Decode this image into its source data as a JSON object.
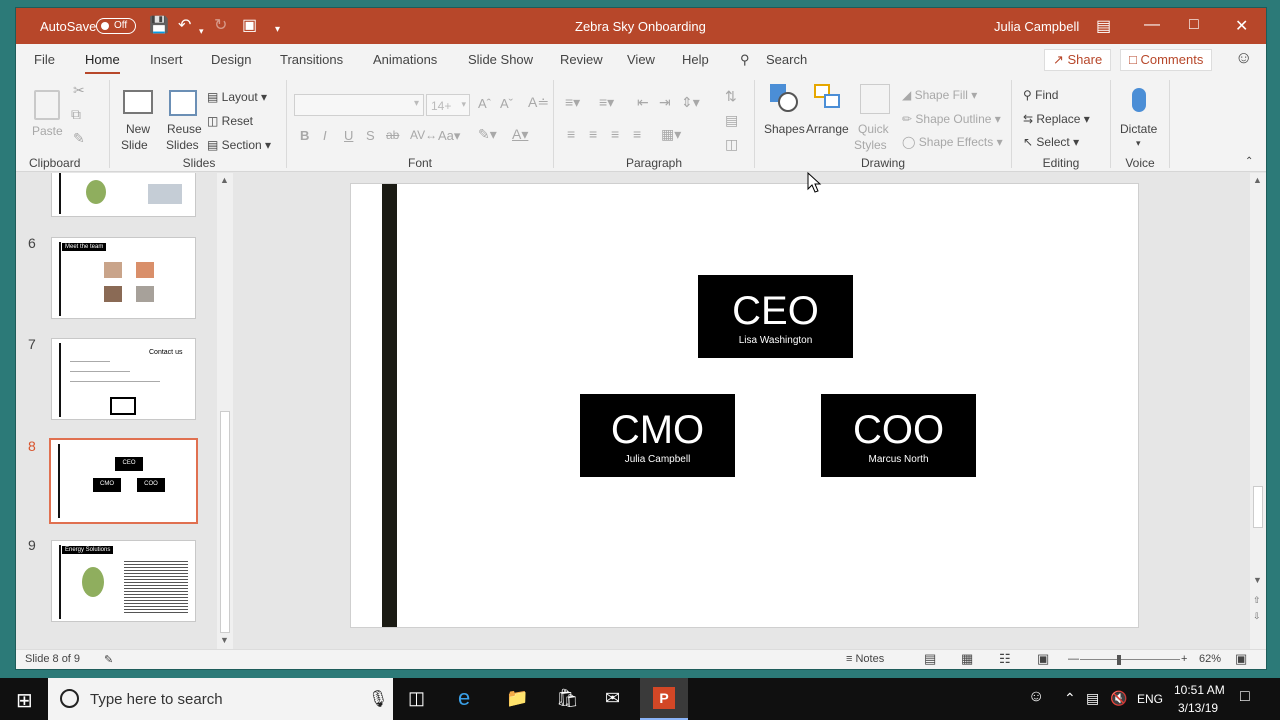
{
  "title_bar": {
    "autosave_label": "AutoSave",
    "autosave_state": "Off",
    "doc_title": "Zebra Sky Onboarding",
    "user_name": "Julia Campbell"
  },
  "tabs": [
    "File",
    "Home",
    "Insert",
    "Design",
    "Transitions",
    "Animations",
    "Slide Show",
    "Review",
    "View",
    "Help"
  ],
  "search_label": "Search",
  "share_label": "Share",
  "comments_label": "Comments",
  "ribbon": {
    "clipboard": {
      "paste": "Paste",
      "group": "Clipboard"
    },
    "slides": {
      "new_slide_1": "New",
      "new_slide_2": "Slide",
      "reuse_1": "Reuse",
      "reuse_2": "Slides",
      "layout": "Layout",
      "reset": "Reset",
      "section": "Section",
      "group": "Slides"
    },
    "font": {
      "size": "14+",
      "group": "Font"
    },
    "paragraph": {
      "group": "Paragraph"
    },
    "drawing": {
      "shapes": "Shapes",
      "arrange": "Arrange",
      "quick_1": "Quick",
      "quick_2": "Styles",
      "shape_fill": "Shape Fill",
      "shape_outline": "Shape Outline",
      "shape_effects": "Shape Effects",
      "group": "Drawing"
    },
    "editing": {
      "find": "Find",
      "replace": "Replace",
      "select": "Select",
      "group": "Editing"
    },
    "voice": {
      "dictate": "Dictate",
      "group": "Voice"
    }
  },
  "thumbnails": [
    {
      "num": "6",
      "title": "Meet the team"
    },
    {
      "num": "7",
      "title": "Contact us"
    },
    {
      "num": "8"
    },
    {
      "num": "9",
      "title": "Energy Solutions"
    }
  ],
  "slide": {
    "ceo": {
      "role": "CEO",
      "name": "Lisa Washington"
    },
    "cmo": {
      "role": "CMO",
      "name": "Julia Campbell"
    },
    "coo": {
      "role": "COO",
      "name": "Marcus North"
    }
  },
  "status_bar": {
    "slide_info": "Slide 8 of 9",
    "notes": "Notes",
    "zoom": "62%",
    "zoom_level": 0.62
  },
  "taskbar": {
    "search_placeholder": "Type here to search",
    "language": "ENG",
    "time": "10:51 AM",
    "date": "3/13/19"
  },
  "colors": {
    "accent": "#b7472a",
    "taskbar": "#101010",
    "desktop": "#2c7a78"
  }
}
